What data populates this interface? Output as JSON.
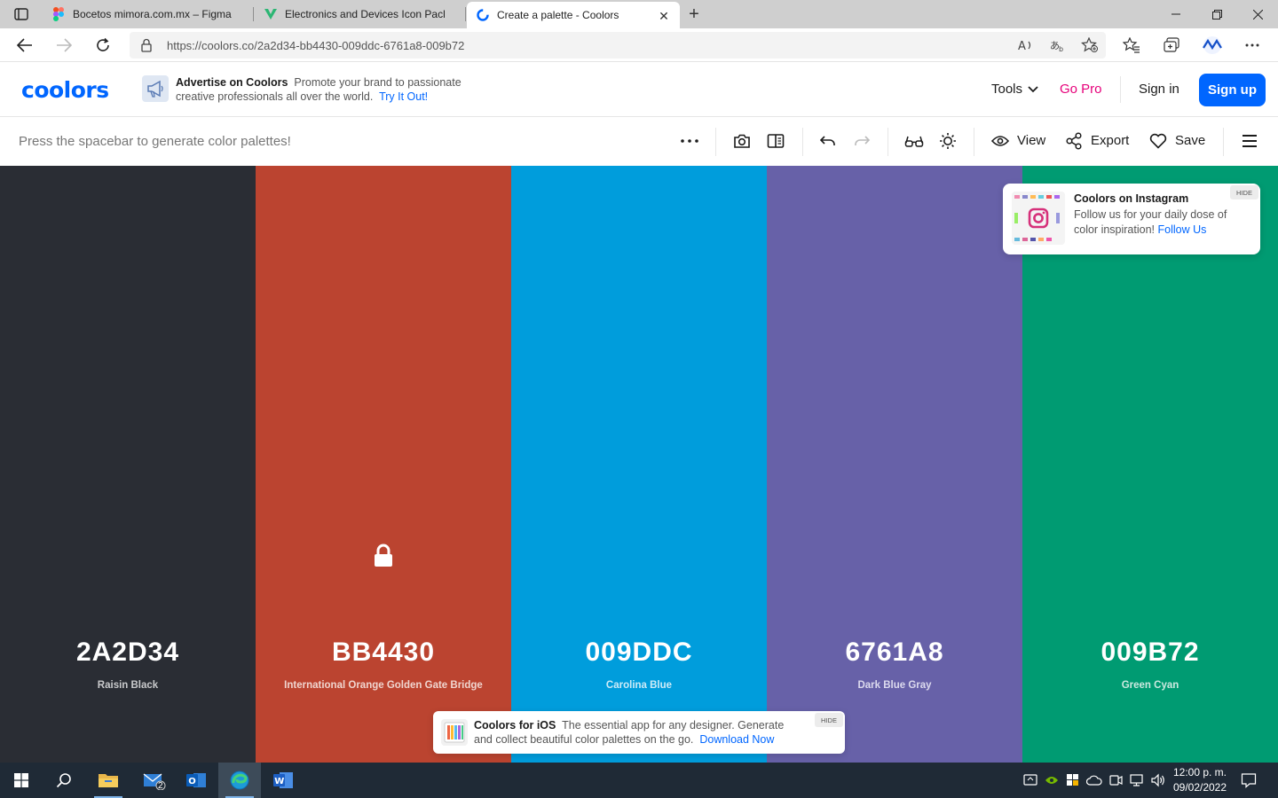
{
  "browser": {
    "tabs": [
      {
        "title": "Bocetos mimora.com.mx – Figma"
      },
      {
        "title": "Electronics and Devices Icon Pack"
      },
      {
        "title": "Create a palette - Coolors"
      }
    ],
    "url": "https://coolors.co/2a2d34-bb4430-009ddc-6761a8-009b72"
  },
  "header": {
    "logo": "coolors",
    "ad_title": "Advertise on Coolors",
    "ad_text": "Promote your brand to passionate creative professionals all over the world.",
    "ad_link": "Try It Out!",
    "tools": "Tools",
    "go_pro": "Go Pro",
    "sign_in": "Sign in",
    "sign_up": "Sign up"
  },
  "toolbar": {
    "hint": "Press the spacebar to generate color palettes!",
    "view": "View",
    "export": "Export",
    "save": "Save"
  },
  "palette": [
    {
      "hex": "2A2D34",
      "name": "Raisin Black",
      "color": "#2a2d34",
      "text_color": "#ffffff",
      "name_color": "#c9cacc",
      "locked": false
    },
    {
      "hex": "BB4430",
      "name": "International Orange Golden Gate Bridge",
      "color": "#bb4430",
      "text_color": "#ffffff",
      "name_color": "#f0d5cf",
      "locked": true
    },
    {
      "hex": "009DDC",
      "name": "Carolina Blue",
      "color": "#009ddc",
      "text_color": "#ffffff",
      "name_color": "#cdebf7",
      "locked": false
    },
    {
      "hex": "6761A8",
      "name": "Dark Blue Gray",
      "color": "#6761a8",
      "text_color": "#ffffff",
      "name_color": "#dcdaee",
      "locked": false
    },
    {
      "hex": "009B72",
      "name": "Green Cyan",
      "color": "#009b72",
      "text_color": "#ffffff",
      "name_color": "#cce9e0",
      "locked": false
    }
  ],
  "instagram_popup": {
    "title": "Coolors on Instagram",
    "text": "Follow us for your daily dose of color inspiration!",
    "link": "Follow Us",
    "hide": "HIDE"
  },
  "ios_popup": {
    "title": "Coolors for iOS",
    "text": "The essential app for any designer. Generate and collect beautiful color palettes on the go.",
    "link": "Download Now",
    "hide": "HIDE"
  },
  "taskbar": {
    "mail_badge": "2",
    "time": "12:00 p. m.",
    "date": "09/02/2022"
  }
}
